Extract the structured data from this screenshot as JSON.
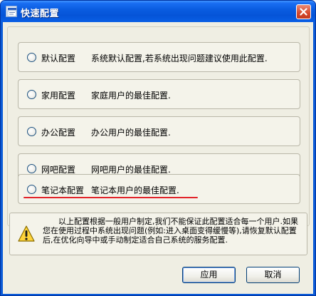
{
  "window": {
    "title": "快速配置",
    "colors": {
      "titlebar": "#0a5de1",
      "client": "#efeee3",
      "underline": "#e2242a"
    }
  },
  "options": [
    {
      "name": "默认配置",
      "desc": "系统默认配置,若系统出现问题建议使用此配置."
    },
    {
      "name": "家用配置",
      "desc": "家庭用户的最佳配置."
    },
    {
      "name": "办公配置",
      "desc": "办公用户的最佳配置."
    },
    {
      "name": "网吧配置",
      "desc": "网吧用户的最佳配置."
    },
    {
      "name": "笔记本配置",
      "desc": "笔记本用户的最佳配置."
    }
  ],
  "info": {
    "icon": "warning-icon",
    "text": "以上配置根据一般用户制定,我们不能保证此配置适合每一个用户.如果您在使用过程中系统出现问题(例如:进入桌面变得缓慢等),请恢复默认配置后,在优化向导中或手动制定适合自己系统的服务配置."
  },
  "buttons": {
    "apply": "应用",
    "cancel": "取消"
  }
}
